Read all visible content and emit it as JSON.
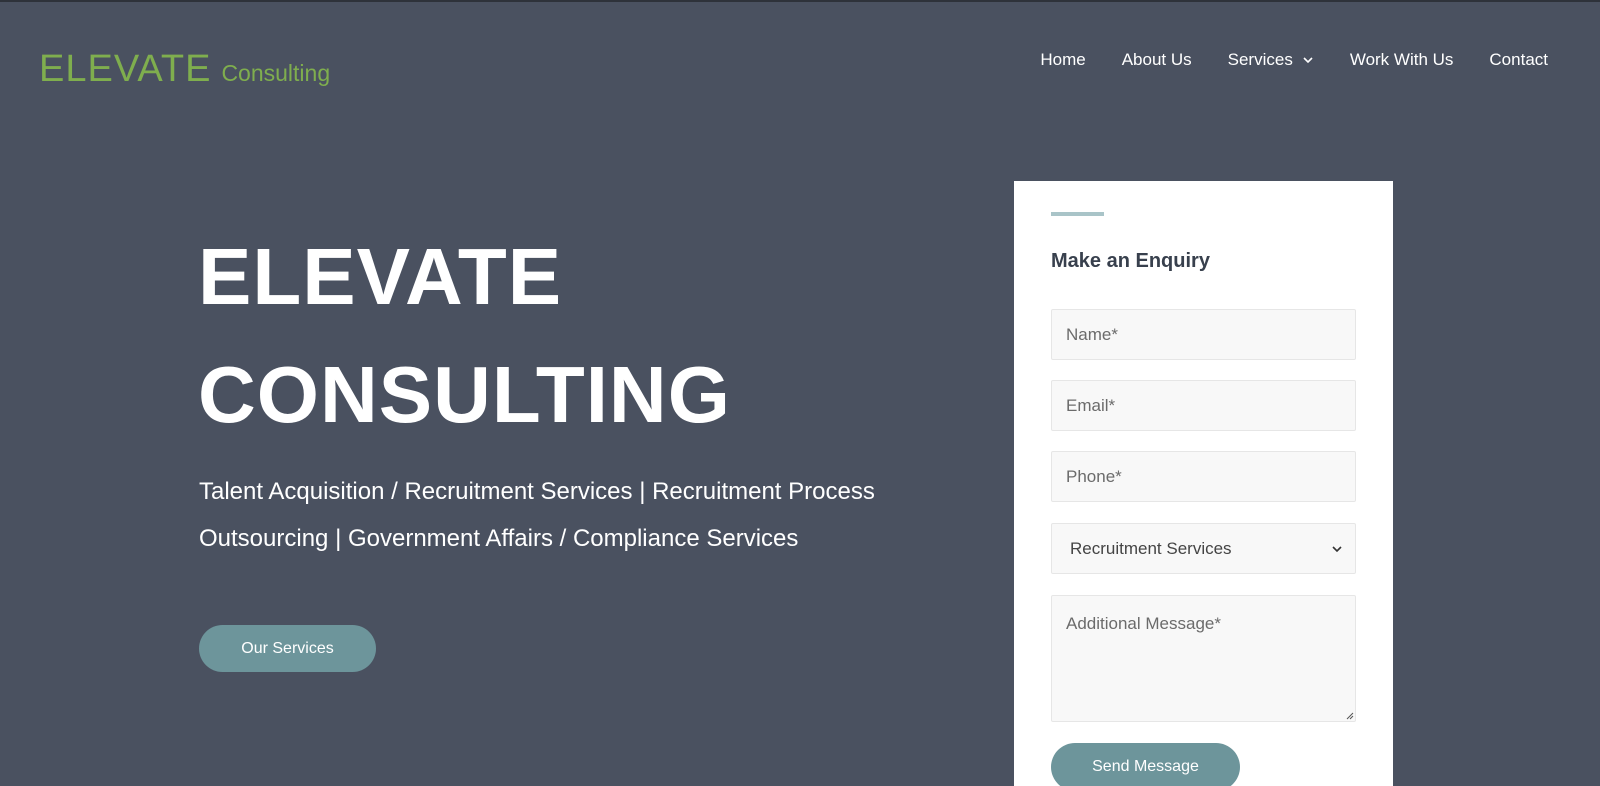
{
  "header": {
    "logo_main": "ELEVATE",
    "logo_sub": "Consulting",
    "nav": [
      {
        "label": "Home"
      },
      {
        "label": "About Us"
      },
      {
        "label": "Services",
        "icon": "chevron-down-icon"
      },
      {
        "label": "Work With Us"
      },
      {
        "label": "Contact"
      }
    ]
  },
  "hero": {
    "title_line1": "ELEVATE",
    "title_line2": "CONSULTING",
    "subtitle": "Talent Acquisition / Recruitment Services | Recruitment Process Outsourcing | Government Affairs / Compliance Services",
    "button": "Our Services"
  },
  "form": {
    "title": "Make an Enquiry",
    "name_placeholder": "Name*",
    "email_placeholder": "Email*",
    "phone_placeholder": "Phone*",
    "service_selected": "Recruitment Services",
    "message_placeholder": "Additional Message*",
    "submit": "Send Message"
  },
  "colors": {
    "background": "#4a5160",
    "logo_green": "#7fae4e",
    "button": "#6d959b",
    "card": "#ffffff"
  }
}
